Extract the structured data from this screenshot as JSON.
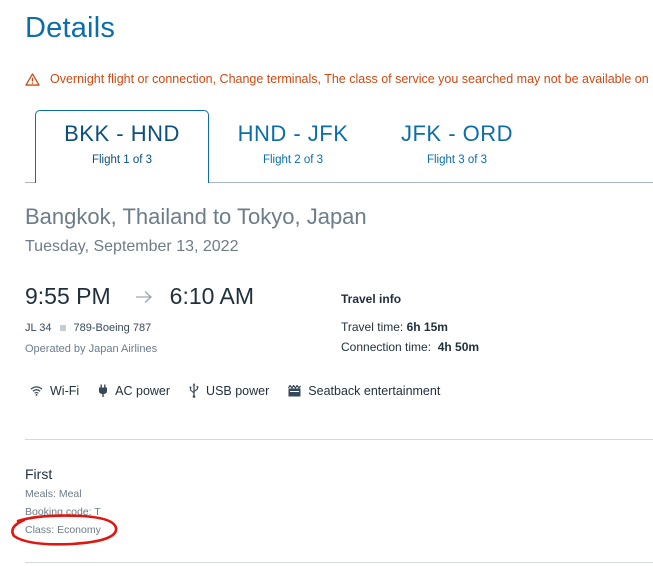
{
  "page": {
    "title": "Details"
  },
  "warning": {
    "text": "Overnight flight or connection, Change terminals, The class of service you searched may not be available on"
  },
  "tabs": [
    {
      "route": "BKK - HND",
      "label": "Flight 1 of 3"
    },
    {
      "route": "HND - JFK",
      "label": "Flight 2 of 3"
    },
    {
      "route": "JFK - ORD",
      "label": "Flight 3 of 3"
    }
  ],
  "segment": {
    "route_title": "Bangkok, Thailand to Tokyo, Japan",
    "date": "Tuesday, September 13, 2022",
    "depart_time": "9:55 PM",
    "arrive_time": "6:10 AM",
    "flight_number": "JL 34",
    "aircraft": "789-Boeing 787",
    "operated_by": "Operated by Japan Airlines"
  },
  "travel_info": {
    "heading": "Travel info",
    "travel_time_label": "Travel time:",
    "travel_time_value": "6h 15m",
    "connection_time_label": "Connection time:",
    "connection_time_value": "4h 50m"
  },
  "amenities": [
    {
      "icon": "wifi-icon",
      "label": "Wi-Fi"
    },
    {
      "icon": "ac-power-icon",
      "label": "AC power"
    },
    {
      "icon": "usb-icon",
      "label": "USB power"
    },
    {
      "icon": "seatback-entertainment-icon",
      "label": "Seatback entertainment"
    }
  ],
  "cabin": {
    "name": "First",
    "meals": "Meals: Meal",
    "booking_code": "Booking code: T",
    "class": "Class: Economy"
  },
  "colors": {
    "accent": "#0b6ea8",
    "warning": "#cd4a14",
    "annotation": "#e0160f"
  }
}
